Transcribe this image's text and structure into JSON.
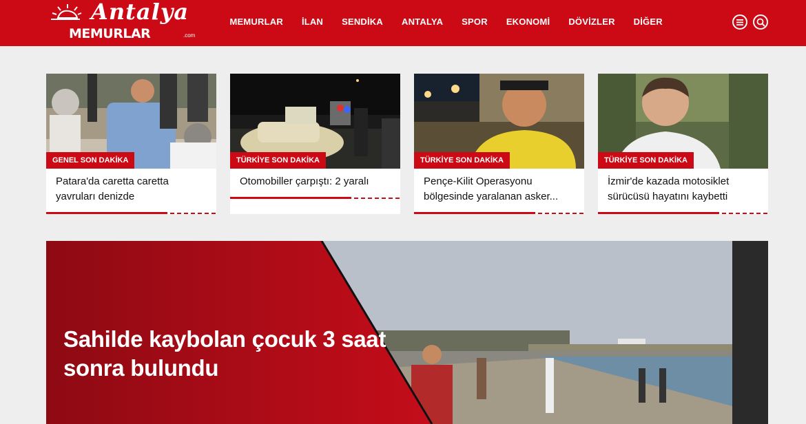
{
  "brand": {
    "script": "Antalya",
    "main": "MEMURLAR",
    "suffix": ".com"
  },
  "nav": {
    "items": [
      "MEMURLAR",
      "İLAN",
      "SENDİKA",
      "ANTALYA",
      "SPOR",
      "EKONOMİ",
      "DÖVİZLER",
      "DİĞER"
    ]
  },
  "header_icons": [
    "menu-icon",
    "search-icon"
  ],
  "cards": [
    {
      "tag": "GENEL SON DAKİKA",
      "title": "Patara'da caretta caretta yavruları denizde"
    },
    {
      "tag": "TÜRKİYE SON DAKİKA",
      "title": "Otomobiller çarpıştı: 2 yaralı"
    },
    {
      "tag": "TÜRKİYE SON DAKİKA",
      "title": "Pençe-Kilit Operasyonu bölgesinde yaralanan asker..."
    },
    {
      "tag": "TÜRKİYE SON DAKİKA",
      "title": "İzmir'de kazada motosiklet sürücüsü hayatını kaybetti"
    }
  ],
  "hero": {
    "title": "Sahilde kaybolan çocuk 3 saat sonra bulundu"
  },
  "colors": {
    "brand_red": "#cc0a16",
    "background": "#eeeeee"
  }
}
